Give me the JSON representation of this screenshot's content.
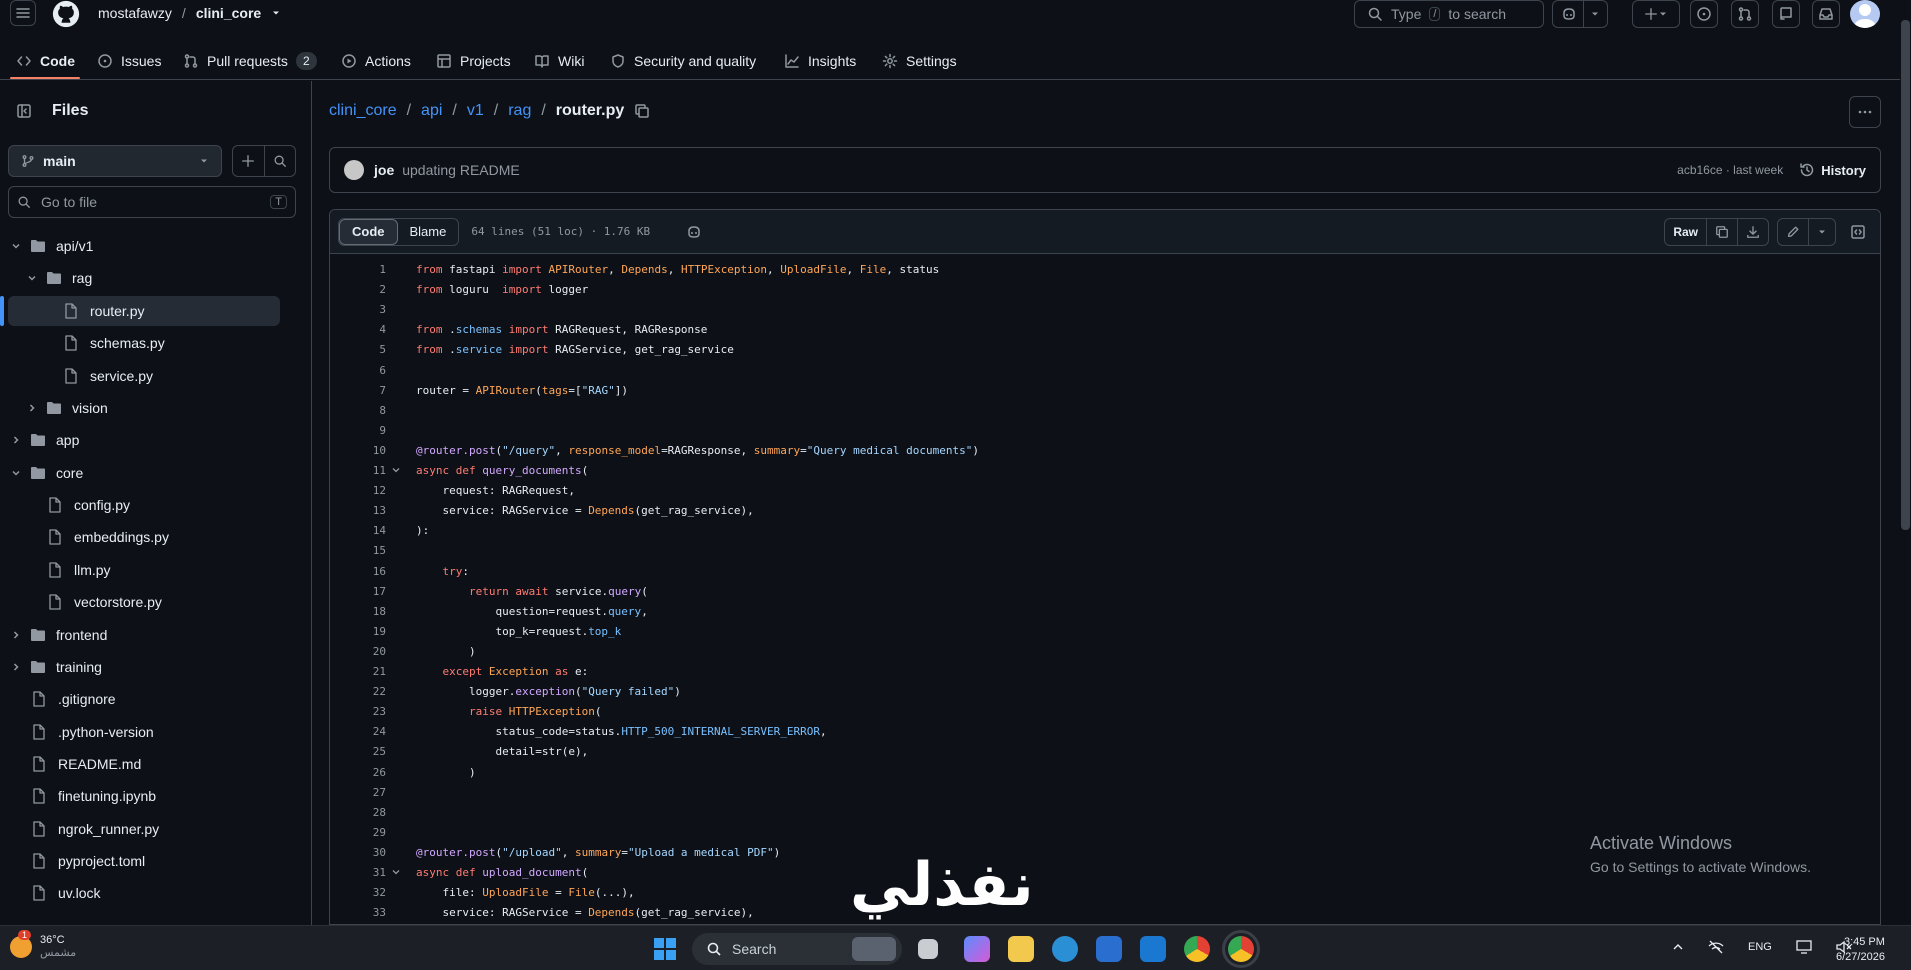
{
  "header": {
    "owner": "mostafawzy",
    "separator": "/",
    "repo": "clini_core",
    "search_prefix": "Type",
    "search_key": "/",
    "search_suffix": "to search"
  },
  "repo_nav": [
    {
      "label": "Code",
      "icon": "code-icon"
    },
    {
      "label": "Issues",
      "icon": "issue-icon"
    },
    {
      "label": "Pull requests",
      "icon": "pull-request-icon",
      "count": "2"
    },
    {
      "label": "Actions",
      "icon": "play-icon"
    },
    {
      "label": "Projects",
      "icon": "table-icon"
    },
    {
      "label": "Wiki",
      "icon": "book-icon"
    },
    {
      "label": "Security and quality",
      "icon": "shield-icon"
    },
    {
      "label": "Insights",
      "icon": "graph-icon"
    },
    {
      "label": "Settings",
      "icon": "gear-icon"
    }
  ],
  "sidebar": {
    "title": "Files",
    "branch": "main",
    "goto_placeholder": "Go to file",
    "goto_key": "T",
    "tree": [
      {
        "label": "api/v1",
        "type": "folder",
        "open": true
      },
      {
        "label": "rag",
        "type": "folder",
        "open": true
      },
      {
        "label": "router.py",
        "type": "file",
        "selected": true
      },
      {
        "label": "schemas.py",
        "type": "file"
      },
      {
        "label": "service.py",
        "type": "file"
      },
      {
        "label": "vision",
        "type": "folder",
        "open": false
      },
      {
        "label": "app",
        "type": "folder",
        "open": false
      },
      {
        "label": "core",
        "type": "folder",
        "open": true
      },
      {
        "label": "config.py",
        "type": "file"
      },
      {
        "label": "embeddings.py",
        "type": "file"
      },
      {
        "label": "llm.py",
        "type": "file"
      },
      {
        "label": "vectorstore.py",
        "type": "file"
      },
      {
        "label": "frontend",
        "type": "folder",
        "open": false
      },
      {
        "label": "training",
        "type": "folder",
        "open": false
      },
      {
        "label": ".gitignore",
        "type": "file"
      },
      {
        "label": ".python-version",
        "type": "file"
      },
      {
        "label": "README.md",
        "type": "file"
      },
      {
        "label": "finetuning.ipynb",
        "type": "file"
      },
      {
        "label": "ngrok_runner.py",
        "type": "file"
      },
      {
        "label": "pyproject.toml",
        "type": "file"
      },
      {
        "label": "uv.lock",
        "type": "file"
      }
    ]
  },
  "path": {
    "parts": [
      "clini_core",
      "api",
      "v1",
      "rag"
    ],
    "current": "router.py"
  },
  "commit": {
    "user": "joe",
    "message": "updating README",
    "meta": "acb16ce · last week",
    "history_label": "History"
  },
  "code_header": {
    "tab_code": "Code",
    "tab_blame": "Blame",
    "info": "64 lines (51 loc) · 1.76 KB",
    "raw_label": "Raw"
  },
  "code_lines": [
    "from fastapi import APIRouter, Depends, HTTPException, UploadFile, File, status",
    "from loguru  import logger",
    "",
    "from .schemas import RAGRequest, RAGResponse",
    "from .service import RAGService, get_rag_service",
    "",
    "router = APIRouter(tags=[\"RAG\"])",
    "",
    "",
    "@router.post(\"/query\", response_model=RAGResponse, summary=\"Query medical documents\")",
    "async def query_documents(",
    "    request: RAGRequest,",
    "    service: RAGService = Depends(get_rag_service),",
    "):",
    "",
    "    try:",
    "        return await service.query(",
    "            question=request.query,",
    "            top_k=request.top_k",
    "        )",
    "    except Exception as e:",
    "        logger.exception(\"Query failed\")",
    "        raise HTTPException(",
    "            status_code=status.HTTP_500_INTERNAL_SERVER_ERROR,",
    "            detail=str(e),",
    "        )",
    "",
    "",
    "",
    "@router.post(\"/upload\", summary=\"Upload a medical PDF\")",
    "async def upload_document(",
    "    file: UploadFile = File(...),",
    "    service: RAGService = Depends(get_rag_service),"
  ],
  "fold_lines": [
    11,
    31
  ],
  "overlay": {
    "activate_title": "Activate Windows",
    "activate_sub": "Go to Settings to activate Windows.",
    "arabic": "نفذلي"
  },
  "taskbar": {
    "temp": "36°C",
    "weather_sub": "مشمس",
    "badge": "1",
    "search": "Search",
    "lang": "ENG",
    "time": "3:45 PM",
    "date": "6/27/2026"
  }
}
